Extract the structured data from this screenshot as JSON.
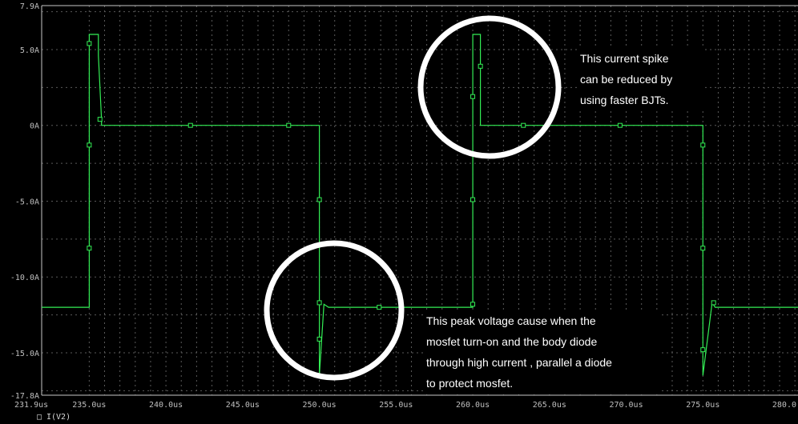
{
  "chart_data": {
    "type": "line",
    "xlim": [
      231.9,
      281.2
    ],
    "ylim": [
      -17.8,
      7.9
    ],
    "x_ticks": [
      {
        "value": 231.9,
        "label": "231.9us"
      },
      {
        "value": 235.0,
        "label": "235.0us"
      },
      {
        "value": 240.0,
        "label": "240.0us"
      },
      {
        "value": 245.0,
        "label": "245.0us"
      },
      {
        "value": 250.0,
        "label": "250.0us"
      },
      {
        "value": 255.0,
        "label": "255.0us"
      },
      {
        "value": 260.0,
        "label": "260.0us"
      },
      {
        "value": 265.0,
        "label": "265.0us"
      },
      {
        "value": 270.0,
        "label": "270.0us"
      },
      {
        "value": 275.0,
        "label": "275.0us"
      },
      {
        "value": 280.0,
        "label": "280.0"
      }
    ],
    "y_ticks": [
      {
        "value": 7.9,
        "label": "7.9A"
      },
      {
        "value": 5.0,
        "label": "5.0A"
      },
      {
        "value": 0,
        "label": "0A"
      },
      {
        "value": -5.0,
        "label": "-5.0A"
      },
      {
        "value": -10.0,
        "label": "-10.0A"
      },
      {
        "value": -15.0,
        "label": "-15.0A"
      },
      {
        "value": -17.8,
        "label": "-17.8A"
      }
    ],
    "grid": true,
    "series": [
      {
        "name": "I(V2)",
        "color": "#33ee55",
        "x": [
          231.9,
          235.0,
          235.0,
          235.6,
          235.6,
          235.8,
          235.8,
          250.0,
          250.0,
          250.3,
          250.6,
          260.0,
          260.0,
          260.5,
          260.5,
          260.6,
          260.6,
          275.0,
          275.0,
          275.6,
          275.8,
          281.2
        ],
        "y": [
          -12.0,
          -12.0,
          6.0,
          6.0,
          4.6,
          0.4,
          0.0,
          0.0,
          -16.5,
          -11.8,
          -12.0,
          -12.0,
          6.0,
          6.0,
          0.0,
          0.0,
          0.0,
          0.0,
          -16.5,
          -11.7,
          -12.0,
          -12.0
        ]
      }
    ],
    "markers": [
      {
        "x": 235.0,
        "y": 5.4
      },
      {
        "x": 235.0,
        "y": -1.3
      },
      {
        "x": 235.0,
        "y": -8.1
      },
      {
        "x": 235.7,
        "y": 0.4
      },
      {
        "x": 241.6,
        "y": 0.0
      },
      {
        "x": 248.0,
        "y": 0.0
      },
      {
        "x": 250.0,
        "y": -4.9
      },
      {
        "x": 250.0,
        "y": -11.7
      },
      {
        "x": 250.0,
        "y": -14.1
      },
      {
        "x": 253.9,
        "y": -12.0
      },
      {
        "x": 260.0,
        "y": 1.9
      },
      {
        "x": 260.5,
        "y": 3.9
      },
      {
        "x": 260.0,
        "y": -4.9
      },
      {
        "x": 260.0,
        "y": -11.8
      },
      {
        "x": 263.3,
        "y": 0.0
      },
      {
        "x": 269.6,
        "y": 0.0
      },
      {
        "x": 275.0,
        "y": -1.3
      },
      {
        "x": 275.0,
        "y": -8.1
      },
      {
        "x": 275.0,
        "y": -14.8
      },
      {
        "x": 275.7,
        "y": -11.7
      }
    ]
  },
  "legend": {
    "marker": "□",
    "label": "I(V2)"
  },
  "annotations": [
    {
      "lines": [
        "This current spike",
        "can be reduced by",
        "using faster BJTs."
      ]
    },
    {
      "lines": [
        "This peak voltage cause when the",
        "mosfet turn-on and the body diode",
        "through high current , parallel a diode",
        "to protect mosfet."
      ]
    }
  ]
}
